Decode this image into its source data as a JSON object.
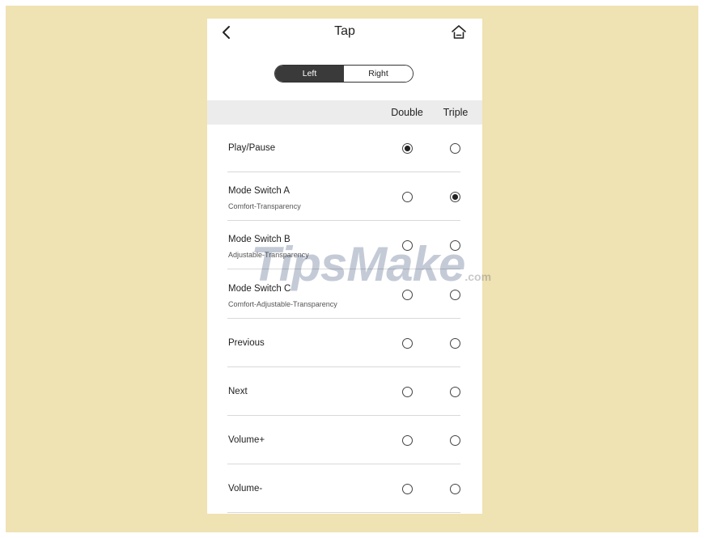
{
  "colors": {
    "background": "#EFE2B3",
    "selected_segment": "#3A3A3A"
  },
  "header": {
    "title": "Tap",
    "back_icon": "chevron-left-icon",
    "home_icon": "home-icon"
  },
  "side_toggle": {
    "left_label": "Left",
    "right_label": "Right",
    "selected": "Left"
  },
  "columns": {
    "double": "Double",
    "triple": "Triple"
  },
  "rows": [
    {
      "label": "Play/Pause",
      "sub": "",
      "double": true,
      "triple": false
    },
    {
      "label": "Mode Switch A",
      "sub": "Comfort-Transparency",
      "double": false,
      "triple": true
    },
    {
      "label": "Mode Switch B",
      "sub": "Adjustable-Transparency",
      "double": false,
      "triple": false
    },
    {
      "label": "Mode Switch C",
      "sub": "Comfort-Adjustable-Transparency",
      "double": false,
      "triple": false
    },
    {
      "label": "Previous",
      "sub": "",
      "double": false,
      "triple": false
    },
    {
      "label": "Next",
      "sub": "",
      "double": false,
      "triple": false
    },
    {
      "label": "Volume+",
      "sub": "",
      "double": false,
      "triple": false
    },
    {
      "label": "Volume-",
      "sub": "",
      "double": false,
      "triple": false
    }
  ],
  "watermark": {
    "main": "TipsMake",
    "suffix": ".com"
  }
}
